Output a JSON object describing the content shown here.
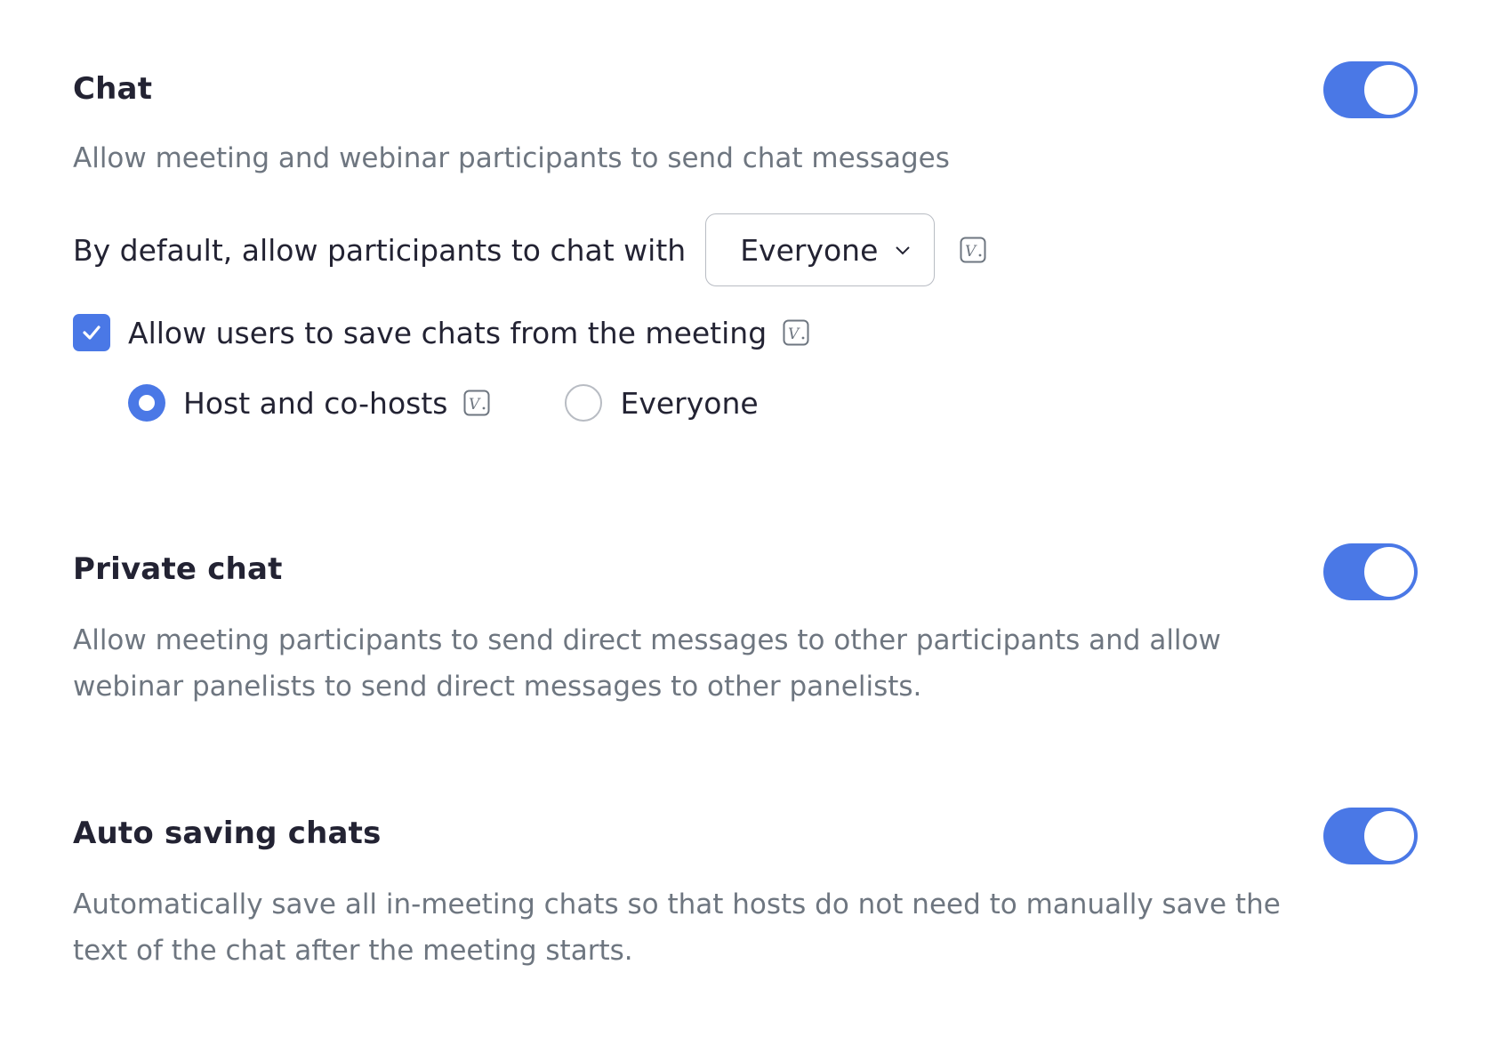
{
  "chat": {
    "title": "Chat",
    "description": "Allow meeting and webinar participants to send chat messages",
    "toggle_on": true,
    "default_label": "By default, allow participants to chat with",
    "default_select_value": "Everyone",
    "save_chats_label": "Allow users to save chats from the meeting",
    "save_chats_checked": true,
    "radio_options": [
      {
        "label": "Host and co-hosts",
        "selected": true
      },
      {
        "label": "Everyone",
        "selected": false
      }
    ]
  },
  "private_chat": {
    "title": "Private chat",
    "description": "Allow meeting participants to send direct messages to other participants and allow webinar panelists to send direct messages to other panelists.",
    "toggle_on": true
  },
  "auto_saving": {
    "title": "Auto saving chats",
    "description": "Automatically save all in-meeting chats so that hosts do not need to manually save the text of the chat after the meeting starts.",
    "toggle_on": true
  },
  "colors": {
    "accent": "#4a78e6",
    "title_text": "#232333",
    "description_text": "#6e7680",
    "border": "#b8bcc3"
  },
  "icons": {
    "version_badge": "version-badge-icon",
    "dropdown": "chevron-down-icon",
    "checkbox": "checkmark-icon"
  }
}
